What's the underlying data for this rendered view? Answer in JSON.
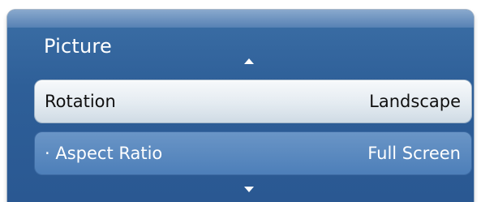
{
  "menu": {
    "title": "Picture",
    "items": [
      {
        "label": "Rotation",
        "value": "Landscape"
      },
      {
        "label": "· Aspect Ratio",
        "value": "Full Screen"
      }
    ]
  },
  "icons": {
    "up": "arrow-up-icon",
    "down": "arrow-down-icon"
  },
  "colors": {
    "panel": "#2e5f98",
    "selected_row": "#e4ebf1",
    "row": "#4d7fb9",
    "text_light": "#ffffff"
  }
}
